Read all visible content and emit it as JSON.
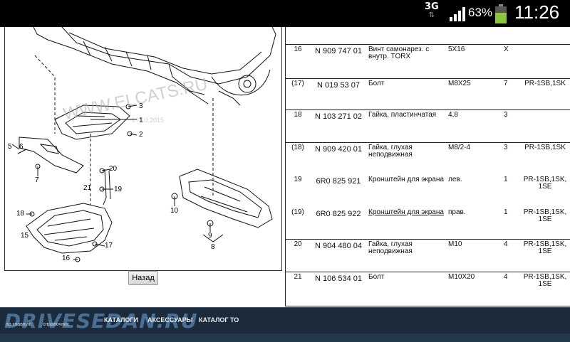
{
  "status_bar": {
    "network": "3G",
    "battery_percent": "63%",
    "time": "11:26"
  },
  "diagram": {
    "watermark_text": "WWW.ELCATS.RU",
    "watermark_date": "27.10.2015",
    "callouts": [
      "1",
      "2",
      "3",
      "5",
      "6",
      "7",
      "8",
      "9",
      "10",
      "15",
      "16",
      "17",
      "18",
      "19",
      "20",
      "21"
    ]
  },
  "back_button": {
    "label": "Назад"
  },
  "parts_table": {
    "rows": [
      {
        "no": "16",
        "part": "N 909 747 01",
        "name": "Винт самонарез. с внутр. TORX",
        "spec": "5X16",
        "qty": "X",
        "code": "",
        "underline": false
      },
      {
        "no": "(17)",
        "part": "N 019 53 07",
        "name": "Болт",
        "spec": "M8X25",
        "qty": "7",
        "code": "PR-1SB,1SK",
        "underline": false
      },
      {
        "no": "18",
        "part": "N 103 271 02",
        "name": "Гайка, пластинчатая",
        "spec": "4,8",
        "qty": "3",
        "code": "",
        "underline": false
      },
      {
        "no": "(18)",
        "part": "N 909 420 01",
        "name": "Гайка, глухая неподвижная",
        "spec": "M8/2-4",
        "qty": "3",
        "code": "PR-1SB,1SK",
        "underline": false
      },
      {
        "no": "19",
        "part": "6R0 825 921",
        "name": "Кронштейн для экрана",
        "spec": "лев.",
        "qty": "1",
        "code": "PR-1SB,1SK, 1SE",
        "underline": false
      },
      {
        "no": "(19)",
        "part": "6R0 825 922",
        "name": "Кронштейн для экрана",
        "spec": "прав.",
        "qty": "1",
        "code": "PR-1SB,1SK, 1SE",
        "underline": true
      },
      {
        "no": "20",
        "part": "N 904 480 04",
        "name": "Гайка, глухая неподвижная",
        "spec": "M10",
        "qty": "4",
        "code": "PR-1SB,1SK, 1SE",
        "underline": false
      },
      {
        "no": "21",
        "part": "N 106 534 01",
        "name": "Болт",
        "spec": "M10X20",
        "qty": "4",
        "code": "PR-1SB,1SK, 1SE",
        "underline": false
      }
    ]
  },
  "footer": {
    "logo_text": "DRIVESEDAN.RU",
    "nav": [
      "КАТАЛОГИ",
      "АКСЕССУАРЫ",
      "КАТАЛОГ ТО"
    ],
    "small_links": [
      "на главную",
      "справочник"
    ]
  }
}
